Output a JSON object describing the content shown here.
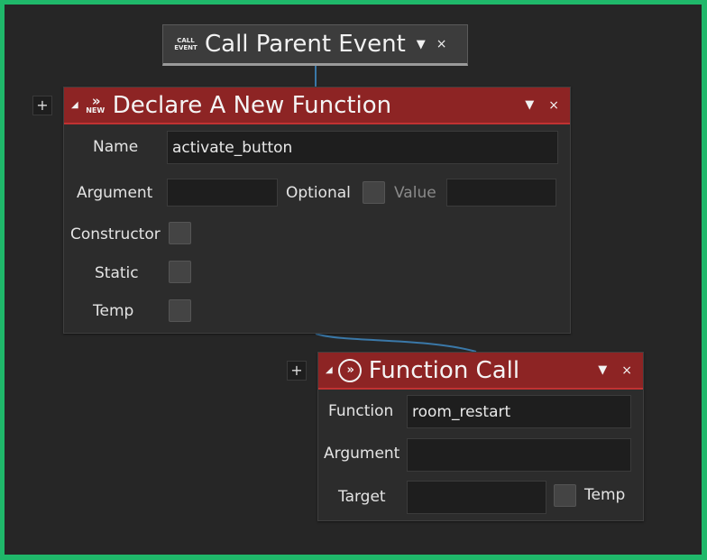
{
  "parent_node": {
    "badge_line1": "CALL",
    "badge_line2": "EVENT",
    "title": "Call Parent Event",
    "menu_arrow": "▼",
    "close": "×"
  },
  "declare_node": {
    "plus": "+",
    "collapse": "◢",
    "badge_chevron": "»",
    "badge_text": "NEW",
    "title": "Declare A New Function",
    "menu_arrow": "▼",
    "close": "×",
    "name_label": "Name",
    "name_value": "activate_button",
    "argument_label": "Argument",
    "argument_value": "",
    "optional_label": "Optional",
    "value_label": "Value",
    "value_value": "",
    "constructor_label": "Constructor",
    "static_label": "Static",
    "temp_label": "Temp"
  },
  "call_node": {
    "plus": "+",
    "collapse": "◢",
    "icon_glyph": "»",
    "title": "Function Call",
    "menu_arrow": "▼",
    "close": "×",
    "function_label": "Function",
    "function_value": "room_restart",
    "argument_label": "Argument",
    "argument_value": "",
    "target_label": "Target",
    "target_value": "",
    "temp_label": "Temp"
  },
  "colors": {
    "frame": "#1fb86a",
    "canvas": "#262626",
    "header_red": "#8d2424",
    "header_accent": "#c03232",
    "wire": "#3a78a8"
  }
}
